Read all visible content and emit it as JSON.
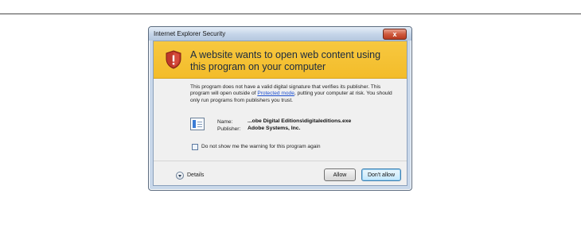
{
  "dialog": {
    "title": "Internet Explorer Security",
    "close_label": "x",
    "headline": "A website wants to open web content using this program on your computer",
    "body_before_link": "This program does not have a valid digital signature that verifies its publisher. This program will open outside of ",
    "body_link": "Protected mode",
    "body_after_link": ", putting your computer at risk. You should only run programs from publishers you trust.",
    "name_label": "Name:",
    "name_value": "...obe Digital Editions\\digitaleditions.exe",
    "publisher_label": "Publisher:",
    "publisher_value": "Adobe Systems, Inc.",
    "checkbox_label": "Do not show me the warning for this program again",
    "checkbox_checked": false,
    "details_label": "Details",
    "allow_label": "Allow",
    "deny_label": "Don't allow"
  },
  "colors": {
    "banner": "#f3bc2a",
    "link": "#1c4fd0",
    "close_button": "#cf5a3e",
    "shield": "#c0392b"
  },
  "icons": {
    "shield": "security-shield-icon",
    "app": "program-icon",
    "details": "expand-chevron-icon"
  }
}
